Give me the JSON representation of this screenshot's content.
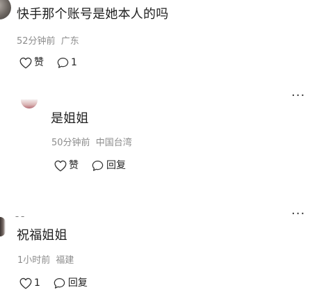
{
  "comments": [
    {
      "text": "快手那个账号是她本人的吗",
      "time": "52分钟前",
      "location": "广东",
      "like_label": "赞",
      "reply_count": "1"
    },
    {
      "text": "是姐姐",
      "time": "50分钟前",
      "location": "中国台湾",
      "like_label": "赞",
      "reply_label": "回复"
    },
    {
      "text": "祝福姐姐",
      "time": "1小时前",
      "location": "福建",
      "like_count": "1",
      "reply_label": "回复"
    }
  ],
  "more_glyph": "···",
  "username_glyph": "– –"
}
